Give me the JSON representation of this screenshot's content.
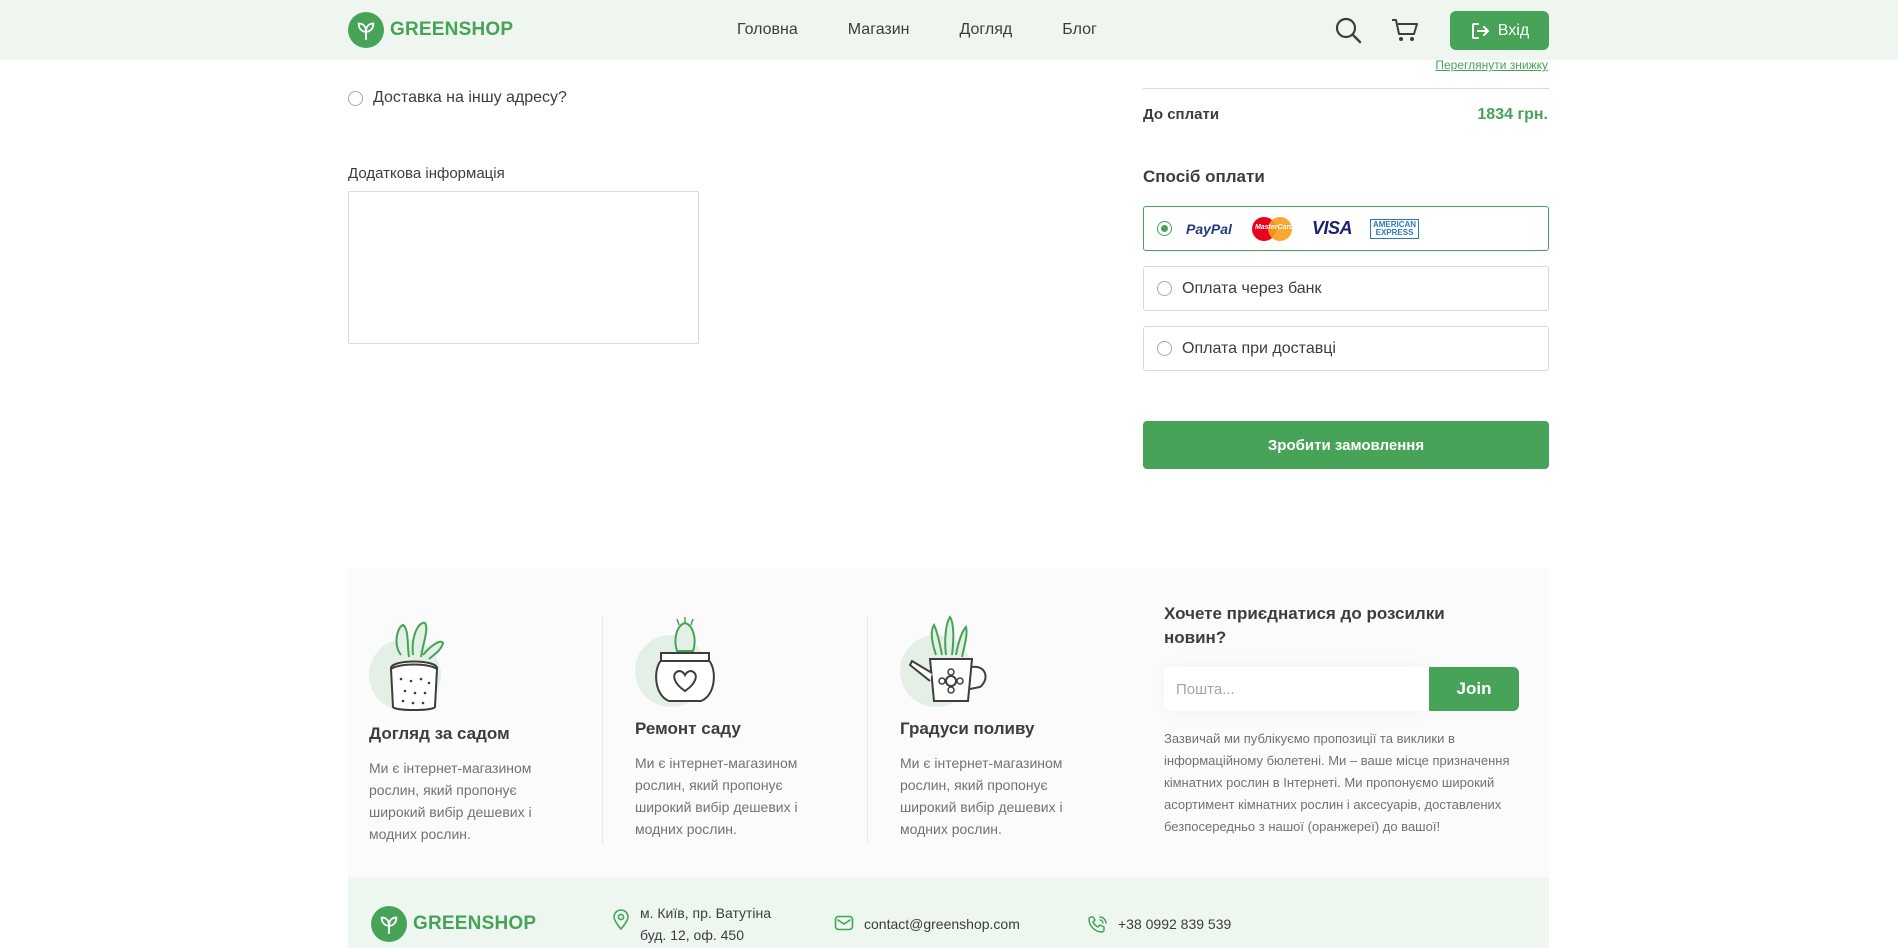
{
  "brand": {
    "name": "GREENSHOP",
    "color": "#46a358"
  },
  "header": {
    "nav": [
      "Головна",
      "Магазин",
      "Догляд",
      "Блог"
    ],
    "search_icon": "search-icon",
    "cart_icon": "cart-icon",
    "login_label": "Вхід"
  },
  "form": {
    "ship_other_label": "Доставка на іншу адресу?",
    "additional_info_label": "Додаткова інформація",
    "additional_info_value": ""
  },
  "summary": {
    "discount_link": "Переглянути знижку",
    "total_label": "До сплати",
    "total_value": "1834 грн.",
    "payment_title": "Спосіб оплати",
    "payment_options": {
      "cards": {
        "paypal": "PayPal",
        "mastercard": "MasterCard",
        "visa": "VISA",
        "amex_line1": "AMERICAN",
        "amex_line2": "EXPRESS"
      },
      "bank": "Оплата через банк",
      "cod": "Оплата при доставці"
    },
    "order_button": "Зробити замовлення"
  },
  "footer": {
    "features": [
      {
        "title": "Догляд за садом",
        "desc": "Ми є інтернет-магазином рослин, який пропонує широкий вибір дешевих і модних рослин."
      },
      {
        "title": "Ремонт саду",
        "desc": "Ми є інтернет-магазином рослин, який пропонує широкий вибір дешевих і модних рослин."
      },
      {
        "title": "Градуси поливу",
        "desc": "Ми є інтернет-магазином рослин, який пропонує широкий вибір дешевих і модних рослин."
      }
    ],
    "newsletter": {
      "title": "Хочете приєднатися до розсилки новин?",
      "placeholder": "Пошта...",
      "join": "Join",
      "desc": "Зазвичай ми публікуємо пропозиції та виклики в інформаційному бюлетені. Ми – ваше місце призначення кімнатних рослин в Інтернеті. Ми пропонуємо широкий асортимент кімнатних рослин і аксесуарів, доставлених безпосередньо з нашої (оранжереї) до вашої!"
    },
    "contacts": {
      "address_line1": "м. Київ, пр. Ватутіна",
      "address_line2": "буд. 12, оф. 450",
      "email": "contact@greenshop.com",
      "phone": "+38 0992 839 539"
    }
  }
}
